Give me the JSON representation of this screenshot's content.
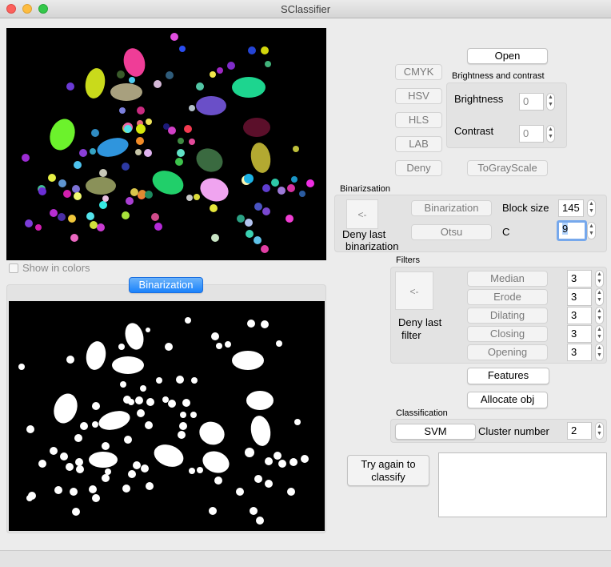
{
  "window": {
    "title": "SClassifier"
  },
  "left": {
    "show_colors_label": "Show in colors",
    "binarization_tab": "Binarization"
  },
  "image_transform": {
    "cmyk": "CMYK",
    "hsv": "HSV",
    "hls": "HLS",
    "lab": "LAB",
    "deny": "Deny",
    "open": "Open",
    "to_gray": "ToGrayScale"
  },
  "brightness_contrast": {
    "title": "Brightness and contrast",
    "brightness_label": "Brightness",
    "brightness_value": "0",
    "contrast_label": "Contrast",
    "contrast_value": "0"
  },
  "binarization": {
    "title": "Binarizsation",
    "deny_arrow": "<-",
    "deny_label_1": "Deny last",
    "deny_label_2": "binarization",
    "binarization_button": "Binarization",
    "otsu_button": "Otsu",
    "block_size_label": "Block size",
    "block_size_value": "145",
    "c_label": "C",
    "c_value": "9"
  },
  "filters": {
    "title": "Filters",
    "deny_arrow": "<-",
    "deny_label_1": "Deny last",
    "deny_label_2": "filter",
    "items": [
      {
        "label": "Median",
        "value": "3"
      },
      {
        "label": "Erode",
        "value": "3"
      },
      {
        "label": "Dilating",
        "value": "3"
      },
      {
        "label": "Closing",
        "value": "3"
      },
      {
        "label": "Opening",
        "value": "3"
      }
    ]
  },
  "features_button": "Features",
  "allocate_button": "Allocate obj",
  "classification": {
    "title": "Classification",
    "svm_button": "SVM",
    "cluster_label": "Cluster number",
    "cluster_value": "2"
  },
  "try_again": {
    "line1": "Try again to",
    "line2": "classify"
  },
  "colors": {
    "accent": "#1a82fb",
    "focus": "#76a8ec"
  }
}
